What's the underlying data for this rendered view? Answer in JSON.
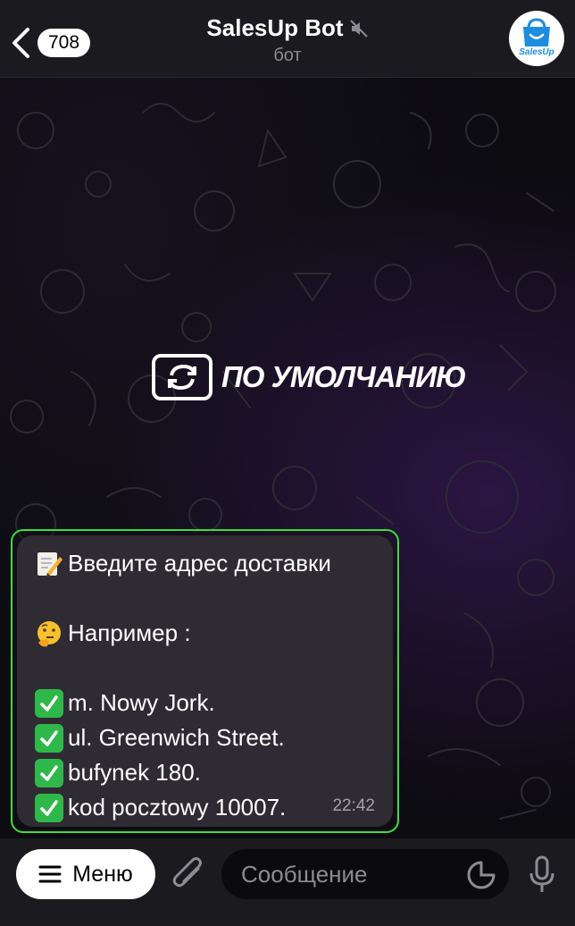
{
  "header": {
    "back_count": "708",
    "title": "SalesUp Bot",
    "subtitle": "бот",
    "avatar_label": "SalesUp"
  },
  "overlay": {
    "text": "ПО УМОЛЧАНИЮ"
  },
  "message": {
    "lines": [
      {
        "icon": "memo-pencil-icon",
        "text": "Введите адрес доставки"
      },
      {
        "icon": "thinking-face-icon",
        "text": "Например :"
      },
      {
        "icon": "check-mark-icon",
        "text": "m. Nowy Jork."
      },
      {
        "icon": "check-mark-icon",
        "text": "ul. Greenwich Street."
      },
      {
        "icon": "check-mark-icon",
        "text": "bufynek 180."
      },
      {
        "icon": "check-mark-icon",
        "text": "kod pocztowy 10007."
      }
    ],
    "time": "22:42",
    "highlight_color": "#3ddc3d"
  },
  "bottombar": {
    "menu_label": "Меню",
    "input_placeholder": "Сообщение"
  },
  "colors": {
    "header_bg": "#1b1a1e",
    "bubble_bg": "#2f2b32",
    "check_green": "#2fb84a",
    "avatar_brand": "#1e8de0"
  }
}
